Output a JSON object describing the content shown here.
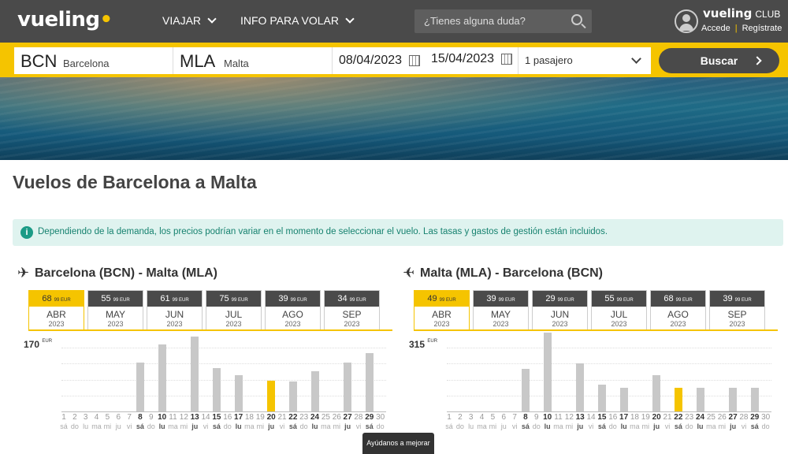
{
  "header": {
    "logo": "vueling",
    "nav": [
      {
        "label": "VIAJAR"
      },
      {
        "label": "INFO PARA VOLAR"
      }
    ],
    "search_placeholder": "¿Tienes alguna duda?",
    "club_brand": "vueling",
    "club_label": "CLUB",
    "login": "Accede",
    "register": "Regístrate"
  },
  "searchbar": {
    "origin_code": "BCN",
    "origin_city": "Barcelona",
    "dest_code": "MLA",
    "dest_city": "Malta",
    "depart_date": "08/04/2023",
    "return_date": "15/04/2023",
    "passengers": "1 pasajero",
    "search_button": "Buscar"
  },
  "page_title": "Vuelos de Barcelona a Malta",
  "info_text": "Dependiendo de la demanda, los precios podrían variar en el momento de seleccionar el vuelo. Las tasas y gastos de gestión están incluidos.",
  "outbound": {
    "title": "Barcelona (BCN) - Malta (MLA)",
    "months": [
      {
        "price": "68",
        "cents": "99 EUR",
        "month": "ABR",
        "year": "2023",
        "active": true
      },
      {
        "price": "55",
        "cents": "99 EUR",
        "month": "MAY",
        "year": "2023"
      },
      {
        "price": "61",
        "cents": "99 EUR",
        "month": "JUN",
        "year": "2023"
      },
      {
        "price": "75",
        "cents": "99 EUR",
        "month": "JUL",
        "year": "2023"
      },
      {
        "price": "39",
        "cents": "99 EUR",
        "month": "AGO",
        "year": "2023"
      },
      {
        "price": "34",
        "cents": "99 EUR",
        "month": "SEP",
        "year": "2023"
      }
    ],
    "max_price": "170",
    "currency": "EUR",
    "days": [
      {
        "d": "1",
        "w": "sá"
      },
      {
        "d": "2",
        "w": "do"
      },
      {
        "d": "3",
        "w": "lu"
      },
      {
        "d": "4",
        "w": "ma"
      },
      {
        "d": "5",
        "w": "mi"
      },
      {
        "d": "6",
        "w": "ju"
      },
      {
        "d": "7",
        "w": "vi"
      },
      {
        "d": "8",
        "w": "sá",
        "a": true,
        "v": 0.54
      },
      {
        "d": "9",
        "w": "do"
      },
      {
        "d": "10",
        "w": "lu",
        "a": true,
        "v": 0.74
      },
      {
        "d": "11",
        "w": "ma"
      },
      {
        "d": "12",
        "w": "mi"
      },
      {
        "d": "13",
        "w": "ju",
        "a": true,
        "v": 0.83
      },
      {
        "d": "14",
        "w": "vi"
      },
      {
        "d": "15",
        "w": "sá",
        "a": true,
        "v": 0.48
      },
      {
        "d": "16",
        "w": "do"
      },
      {
        "d": "17",
        "w": "lu",
        "a": true,
        "v": 0.4
      },
      {
        "d": "18",
        "w": "ma"
      },
      {
        "d": "19",
        "w": "mi"
      },
      {
        "d": "20",
        "w": "ju",
        "a": true,
        "v": 0.34,
        "sel": true
      },
      {
        "d": "21",
        "w": "vi"
      },
      {
        "d": "22",
        "w": "sá",
        "a": true,
        "v": 0.33
      },
      {
        "d": "23",
        "w": "do"
      },
      {
        "d": "24",
        "w": "lu",
        "a": true,
        "v": 0.44
      },
      {
        "d": "25",
        "w": "ma"
      },
      {
        "d": "26",
        "w": "mi"
      },
      {
        "d": "27",
        "w": "ju",
        "a": true,
        "v": 0.54
      },
      {
        "d": "28",
        "w": "vi"
      },
      {
        "d": "29",
        "w": "sá",
        "a": true,
        "v": 0.64
      },
      {
        "d": "30",
        "w": "do"
      }
    ]
  },
  "inbound": {
    "title": "Malta (MLA) - Barcelona (BCN)",
    "months": [
      {
        "price": "49",
        "cents": "99 EUR",
        "month": "ABR",
        "year": "2023",
        "active": true
      },
      {
        "price": "39",
        "cents": "99 EUR",
        "month": "MAY",
        "year": "2023"
      },
      {
        "price": "29",
        "cents": "99 EUR",
        "month": "JUN",
        "year": "2023"
      },
      {
        "price": "55",
        "cents": "99 EUR",
        "month": "JUL",
        "year": "2023"
      },
      {
        "price": "68",
        "cents": "99 EUR",
        "month": "AGO",
        "year": "2023"
      },
      {
        "price": "39",
        "cents": "99 EUR",
        "month": "SEP",
        "year": "2023"
      }
    ],
    "max_price": "315",
    "currency": "EUR",
    "days": [
      {
        "d": "1",
        "w": "sá"
      },
      {
        "d": "2",
        "w": "do"
      },
      {
        "d": "3",
        "w": "lu"
      },
      {
        "d": "4",
        "w": "ma"
      },
      {
        "d": "5",
        "w": "mi"
      },
      {
        "d": "6",
        "w": "ju"
      },
      {
        "d": "7",
        "w": "vi"
      },
      {
        "d": "8",
        "w": "sá",
        "a": true,
        "v": 0.47
      },
      {
        "d": "9",
        "w": "do"
      },
      {
        "d": "10",
        "w": "lu",
        "a": true,
        "v": 0.87
      },
      {
        "d": "11",
        "w": "ma"
      },
      {
        "d": "12",
        "w": "mi"
      },
      {
        "d": "13",
        "w": "ju",
        "a": true,
        "v": 0.53
      },
      {
        "d": "14",
        "w": "vi"
      },
      {
        "d": "15",
        "w": "sá",
        "a": true,
        "v": 0.3
      },
      {
        "d": "16",
        "w": "do"
      },
      {
        "d": "17",
        "w": "lu",
        "a": true,
        "v": 0.26
      },
      {
        "d": "18",
        "w": "ma"
      },
      {
        "d": "19",
        "w": "mi"
      },
      {
        "d": "20",
        "w": "ju",
        "a": true,
        "v": 0.4
      },
      {
        "d": "21",
        "w": "vi"
      },
      {
        "d": "22",
        "w": "sá",
        "a": true,
        "v": 0.26,
        "sel": true
      },
      {
        "d": "23",
        "w": "do"
      },
      {
        "d": "24",
        "w": "lu",
        "a": true,
        "v": 0.26
      },
      {
        "d": "25",
        "w": "ma"
      },
      {
        "d": "26",
        "w": "mi"
      },
      {
        "d": "27",
        "w": "ju",
        "a": true,
        "v": 0.26
      },
      {
        "d": "28",
        "w": "vi"
      },
      {
        "d": "29",
        "w": "sá",
        "a": true,
        "v": 0.26
      },
      {
        "d": "30",
        "w": "do"
      }
    ]
  },
  "feedback_button": "Ayúdanos a mejorar"
}
